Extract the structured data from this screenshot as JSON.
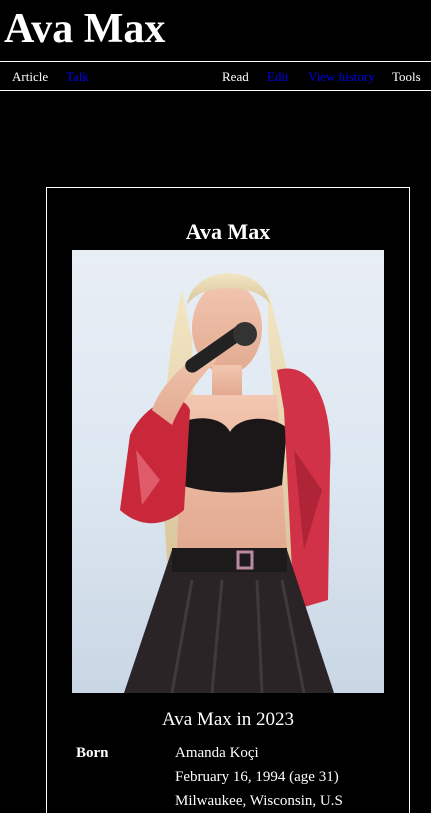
{
  "page": {
    "title": "Ava Max"
  },
  "tabs": {
    "article": "Article",
    "talk": "Talk",
    "read": "Read",
    "edit": "Edit",
    "view_history": "View history",
    "tools": "Tools"
  },
  "infobox": {
    "title": "Ava Max",
    "image_caption": "Ava Max in 2023",
    "born_label": "Born",
    "born_name": "Amanda Koçi",
    "born_date": "February 16, 1994 (age 31)",
    "born_place": "Milwaukee, Wisconsin, U.S"
  },
  "colors": {
    "background": "#000000",
    "text": "#ffffff",
    "link": "#0000ee"
  }
}
